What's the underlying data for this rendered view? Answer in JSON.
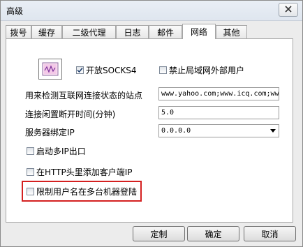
{
  "window": {
    "title": "高级"
  },
  "tabs": [
    {
      "label": "拨号"
    },
    {
      "label": "缓存"
    },
    {
      "label": "二级代理"
    },
    {
      "label": "日志"
    },
    {
      "label": "邮件"
    },
    {
      "label": "网络",
      "active": true
    },
    {
      "label": "其他"
    }
  ],
  "network": {
    "enable_socks_label": "开放SOCKS4",
    "enable_socks_checked": true,
    "block_external_label": "禁止局域网外部用户",
    "block_external_checked": false,
    "check_sites_label": "用来检测互联网连接状态的站点",
    "check_sites_value": "www.yahoo.com;www.icq.com;ww",
    "idle_timeout_label": "连接闲置断开时间(分钟)",
    "idle_timeout_value": "5.0",
    "bind_ip_label": "服务器绑定IP",
    "bind_ip_value": "0.0.0.0",
    "multi_ip_label": "启动多IP出口",
    "multi_ip_checked": false,
    "add_client_ip_label": "在HTTP头里添加客户端IP",
    "add_client_ip_checked": false,
    "limit_multi_login_label": "限制用户名在多台机器登陆",
    "limit_multi_login_checked": false
  },
  "buttons": {
    "customize": "定制",
    "ok": "确定",
    "cancel": "取消"
  },
  "icons": {
    "close": "close-icon",
    "network_app": "network-monitor-icon",
    "checkmark": "checkmark-icon"
  },
  "colors": {
    "highlight_border": "#d42020"
  }
}
